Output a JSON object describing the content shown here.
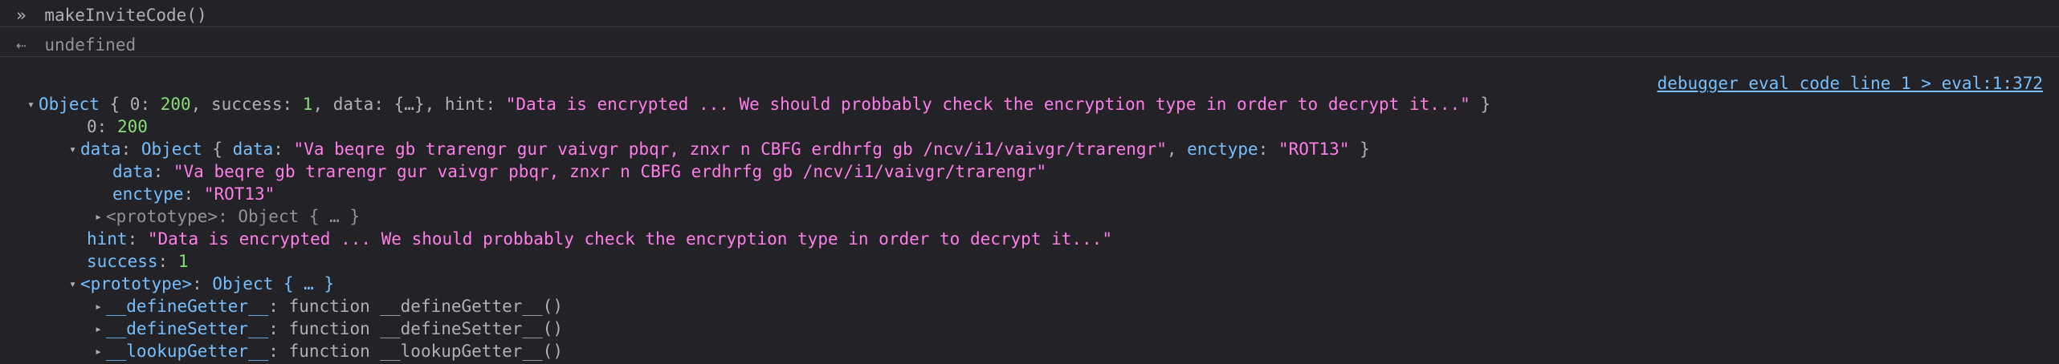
{
  "input": {
    "prompt_icon": "chevron-double-right",
    "code": "makeInviteCode()"
  },
  "result": {
    "return_icon": "arrow-left",
    "value": "undefined"
  },
  "object": {
    "summary_label": "Object",
    "summary_parts": {
      "open": " { ",
      "k0": "0",
      "v0": "200",
      "k_success": "success",
      "v_success": "1",
      "k_data": "data",
      "v_data": "{…}",
      "k_hint": "hint",
      "v_hint": "\"Data is encrypted ... We should probbably check the encryption type in order to decrypt it...\"",
      "close": " }"
    },
    "source_link": "debugger eval code line 1 > eval:1:372",
    "prop_0": {
      "key": "0",
      "value": "200"
    },
    "data_prop": {
      "key": "data",
      "summary_label": "Object",
      "summary_data_key": "data",
      "summary_data_value": "\"Va beqre gb trarengr gur vaivgr pbqr, znxr n CBFG erdhrfg gb /ncv/i1/vaivgr/trarengr\"",
      "summary_enctype_key": "enctype",
      "summary_enctype_value": "\"ROT13\"",
      "children": {
        "data_key": "data",
        "data_value": "\"Va beqre gb trarengr gur vaivgr pbqr, znxr n CBFG erdhrfg gb /ncv/i1/vaivgr/trarengr\"",
        "enctype_key": "enctype",
        "enctype_value": "\"ROT13\"",
        "prototype_key": "<prototype>",
        "prototype_value": "Object { … }"
      }
    },
    "hint_prop": {
      "key": "hint",
      "value": "\"Data is encrypted ... We should probbably check the encryption type in order to decrypt it...\""
    },
    "success_prop": {
      "key": "success",
      "value": "1"
    },
    "prototype_prop": {
      "key": "<prototype>",
      "value": "Object { … }",
      "children": [
        {
          "key": "__defineGetter__",
          "value": "function __defineGetter__()"
        },
        {
          "key": "__defineSetter__",
          "value": "function __defineSetter__()"
        },
        {
          "key": "__lookupGetter__",
          "value": "function __lookupGetter__()"
        }
      ]
    }
  },
  "colors": {
    "background": "#232327",
    "key": "#75bfff",
    "string": "#ff7de9",
    "number": "#86de74",
    "text": "#b1b1b3",
    "muted": "#939395"
  }
}
